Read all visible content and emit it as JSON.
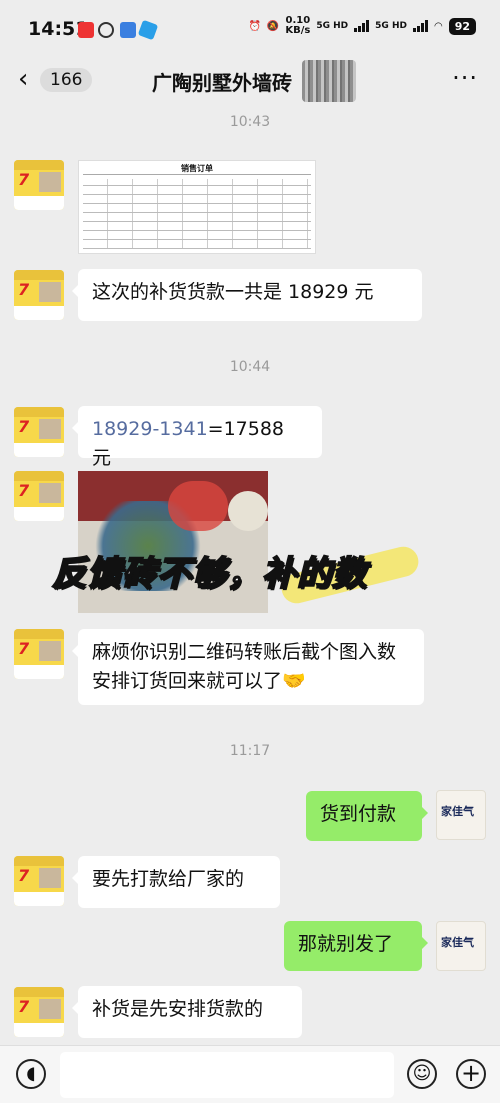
{
  "status_bar": {
    "time": "14:51",
    "speed_value": "0.10",
    "speed_unit": "KB/s",
    "network1": "5G HD",
    "network2": "5G HD",
    "battery": "92"
  },
  "header": {
    "unread_count": "166",
    "title": "广陶别墅外墙砖"
  },
  "timestamps": [
    "10:43",
    "10:44",
    "11:17"
  ],
  "messages": [
    {
      "side": "in",
      "type": "image",
      "caption": "销售订单"
    },
    {
      "side": "in",
      "type": "text",
      "text": "这次的补货货款一共是 18929 元"
    },
    {
      "side": "in",
      "type": "text",
      "link": "18929-1341",
      "text": "=17588 元"
    },
    {
      "side": "in",
      "type": "image",
      "overlay": "反馈砖不够，补的数"
    },
    {
      "side": "in",
      "type": "text",
      "text": "麻烦你识别二维码转账后截个图入数安排订货回来就可以了🤝"
    },
    {
      "side": "out",
      "type": "text",
      "text": "货到付款"
    },
    {
      "side": "in",
      "type": "text",
      "text": "要先打款给厂家的"
    },
    {
      "side": "out",
      "type": "text",
      "text": "那就别发了"
    },
    {
      "side": "in",
      "type": "text",
      "text": "补货是先安排货款的"
    }
  ],
  "avatar_left": {
    "label": "7"
  },
  "avatar_right": {
    "label": "家佳气"
  },
  "colors": {
    "outgoing_bubble": "#95ec69",
    "incoming_bubble": "#ffffff",
    "background": "#ededed",
    "link": "#566c9f"
  }
}
